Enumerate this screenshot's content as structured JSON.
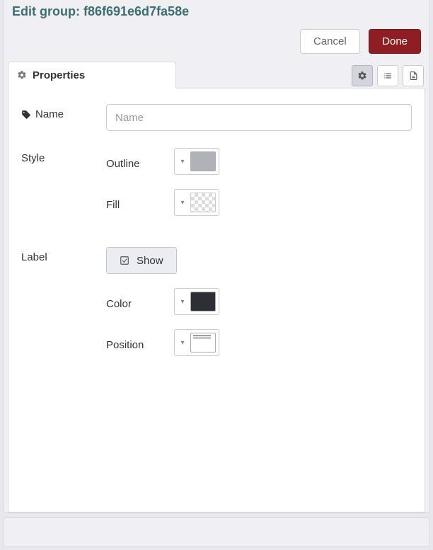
{
  "header": {
    "title": "Edit group: f86f691e6d7fa58e"
  },
  "actions": {
    "cancel_label": "Cancel",
    "done_label": "Done"
  },
  "tabs": {
    "properties_label": "Properties"
  },
  "form": {
    "name": {
      "label": "Name",
      "placeholder": "Name",
      "value": ""
    },
    "style": {
      "label": "Style",
      "outline_label": "Outline",
      "fill_label": "Fill",
      "outline_color": "#b1b1b8",
      "fill_color": "transparent"
    },
    "label_group": {
      "label": "Label",
      "show_label": "Show",
      "color_label": "Color",
      "position_label": "Position",
      "label_color": "#2e2e36"
    }
  }
}
